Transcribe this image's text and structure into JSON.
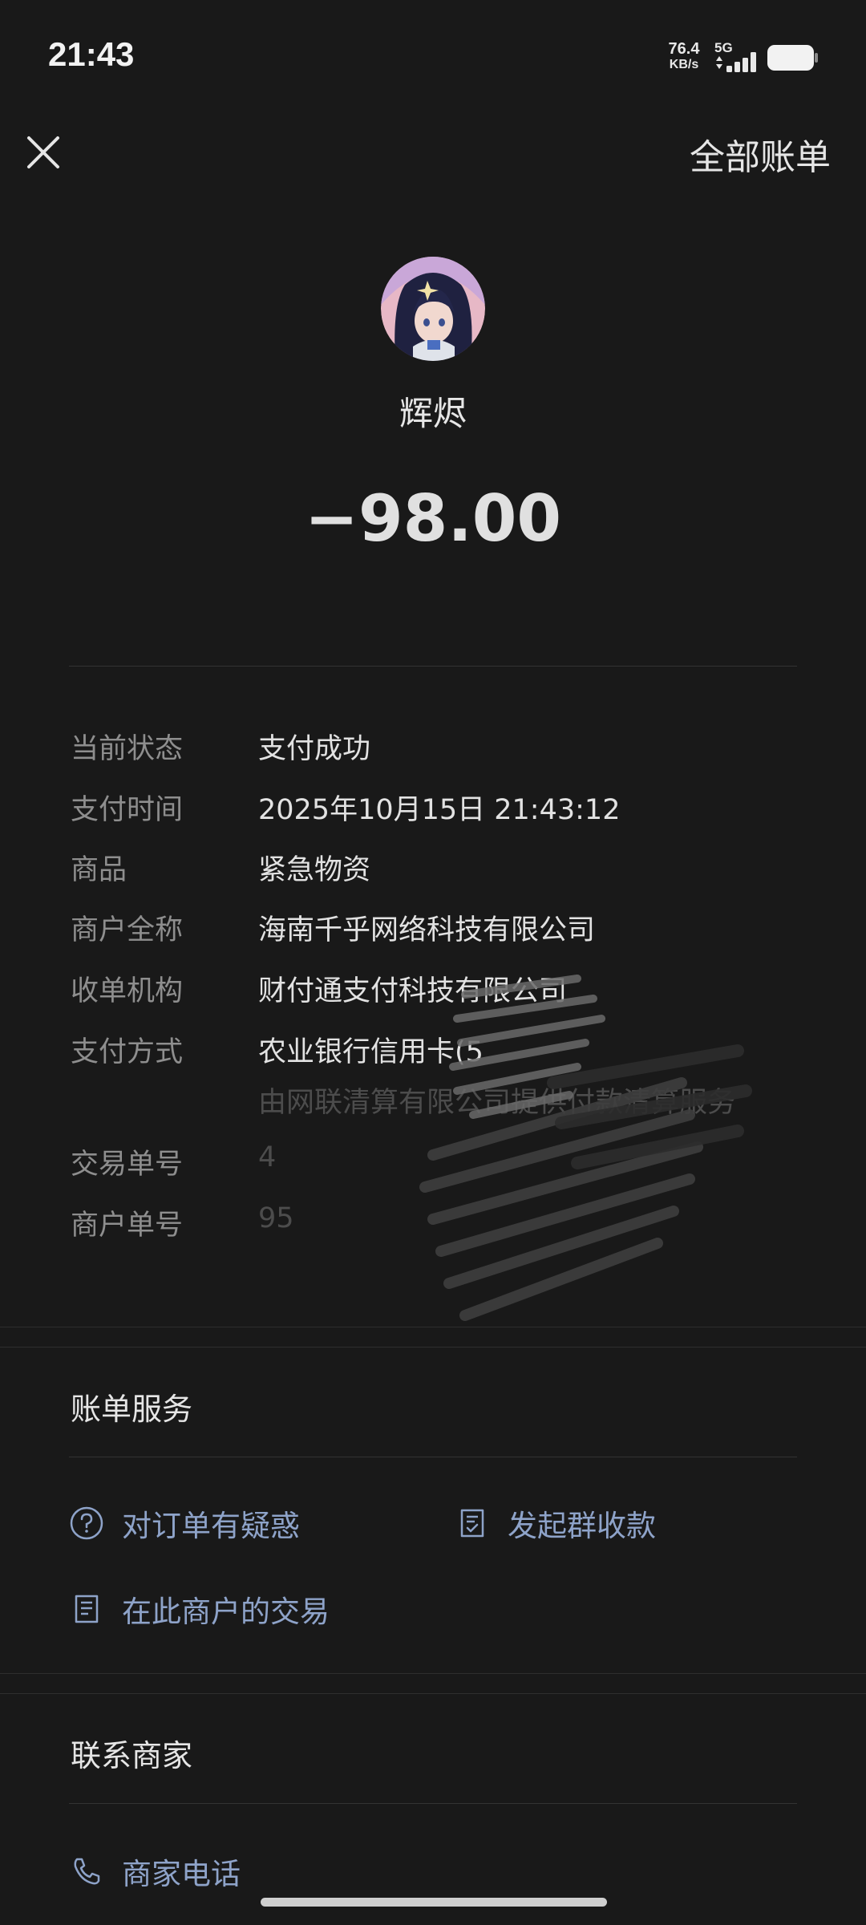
{
  "status_bar": {
    "time": "21:43",
    "net_speed_value": "76.4",
    "net_speed_unit": "KB/s",
    "network_type": "5G"
  },
  "header": {
    "close_icon": "close-icon",
    "all_bills": "全部账单"
  },
  "merchant": {
    "name": "辉烬",
    "amount": "−98.00"
  },
  "details": {
    "status_label": "当前状态",
    "status_value": "支付成功",
    "time_label": "支付时间",
    "time_value": "2025年10月15日 21:43:12",
    "goods_label": "商品",
    "goods_value": "紧急物资",
    "merchant_full_label": "商户全称",
    "merchant_full_value": "海南千乎网络科技有限公司",
    "acquirer_label": "收单机构",
    "acquirer_value": "财付通支付科技有限公司",
    "pay_method_label": "支付方式",
    "pay_method_value": "农业银行信用卡(5",
    "pay_method_sub": "由网联清算有限公司提供付款清算服务",
    "trade_no_label": "交易单号",
    "trade_no_value": "4",
    "merchant_no_label": "商户单号",
    "merchant_no_value": "95"
  },
  "bill_service": {
    "title": "账单服务",
    "question": "对订单有疑惑",
    "group_collect": "发起群收款",
    "merchant_trades": "在此商户的交易"
  },
  "contact": {
    "title": "联系商家",
    "phone": "商家电话"
  },
  "colors": {
    "background": "#191919",
    "link": "#8ea3c9",
    "label": "#8e8e8e"
  }
}
